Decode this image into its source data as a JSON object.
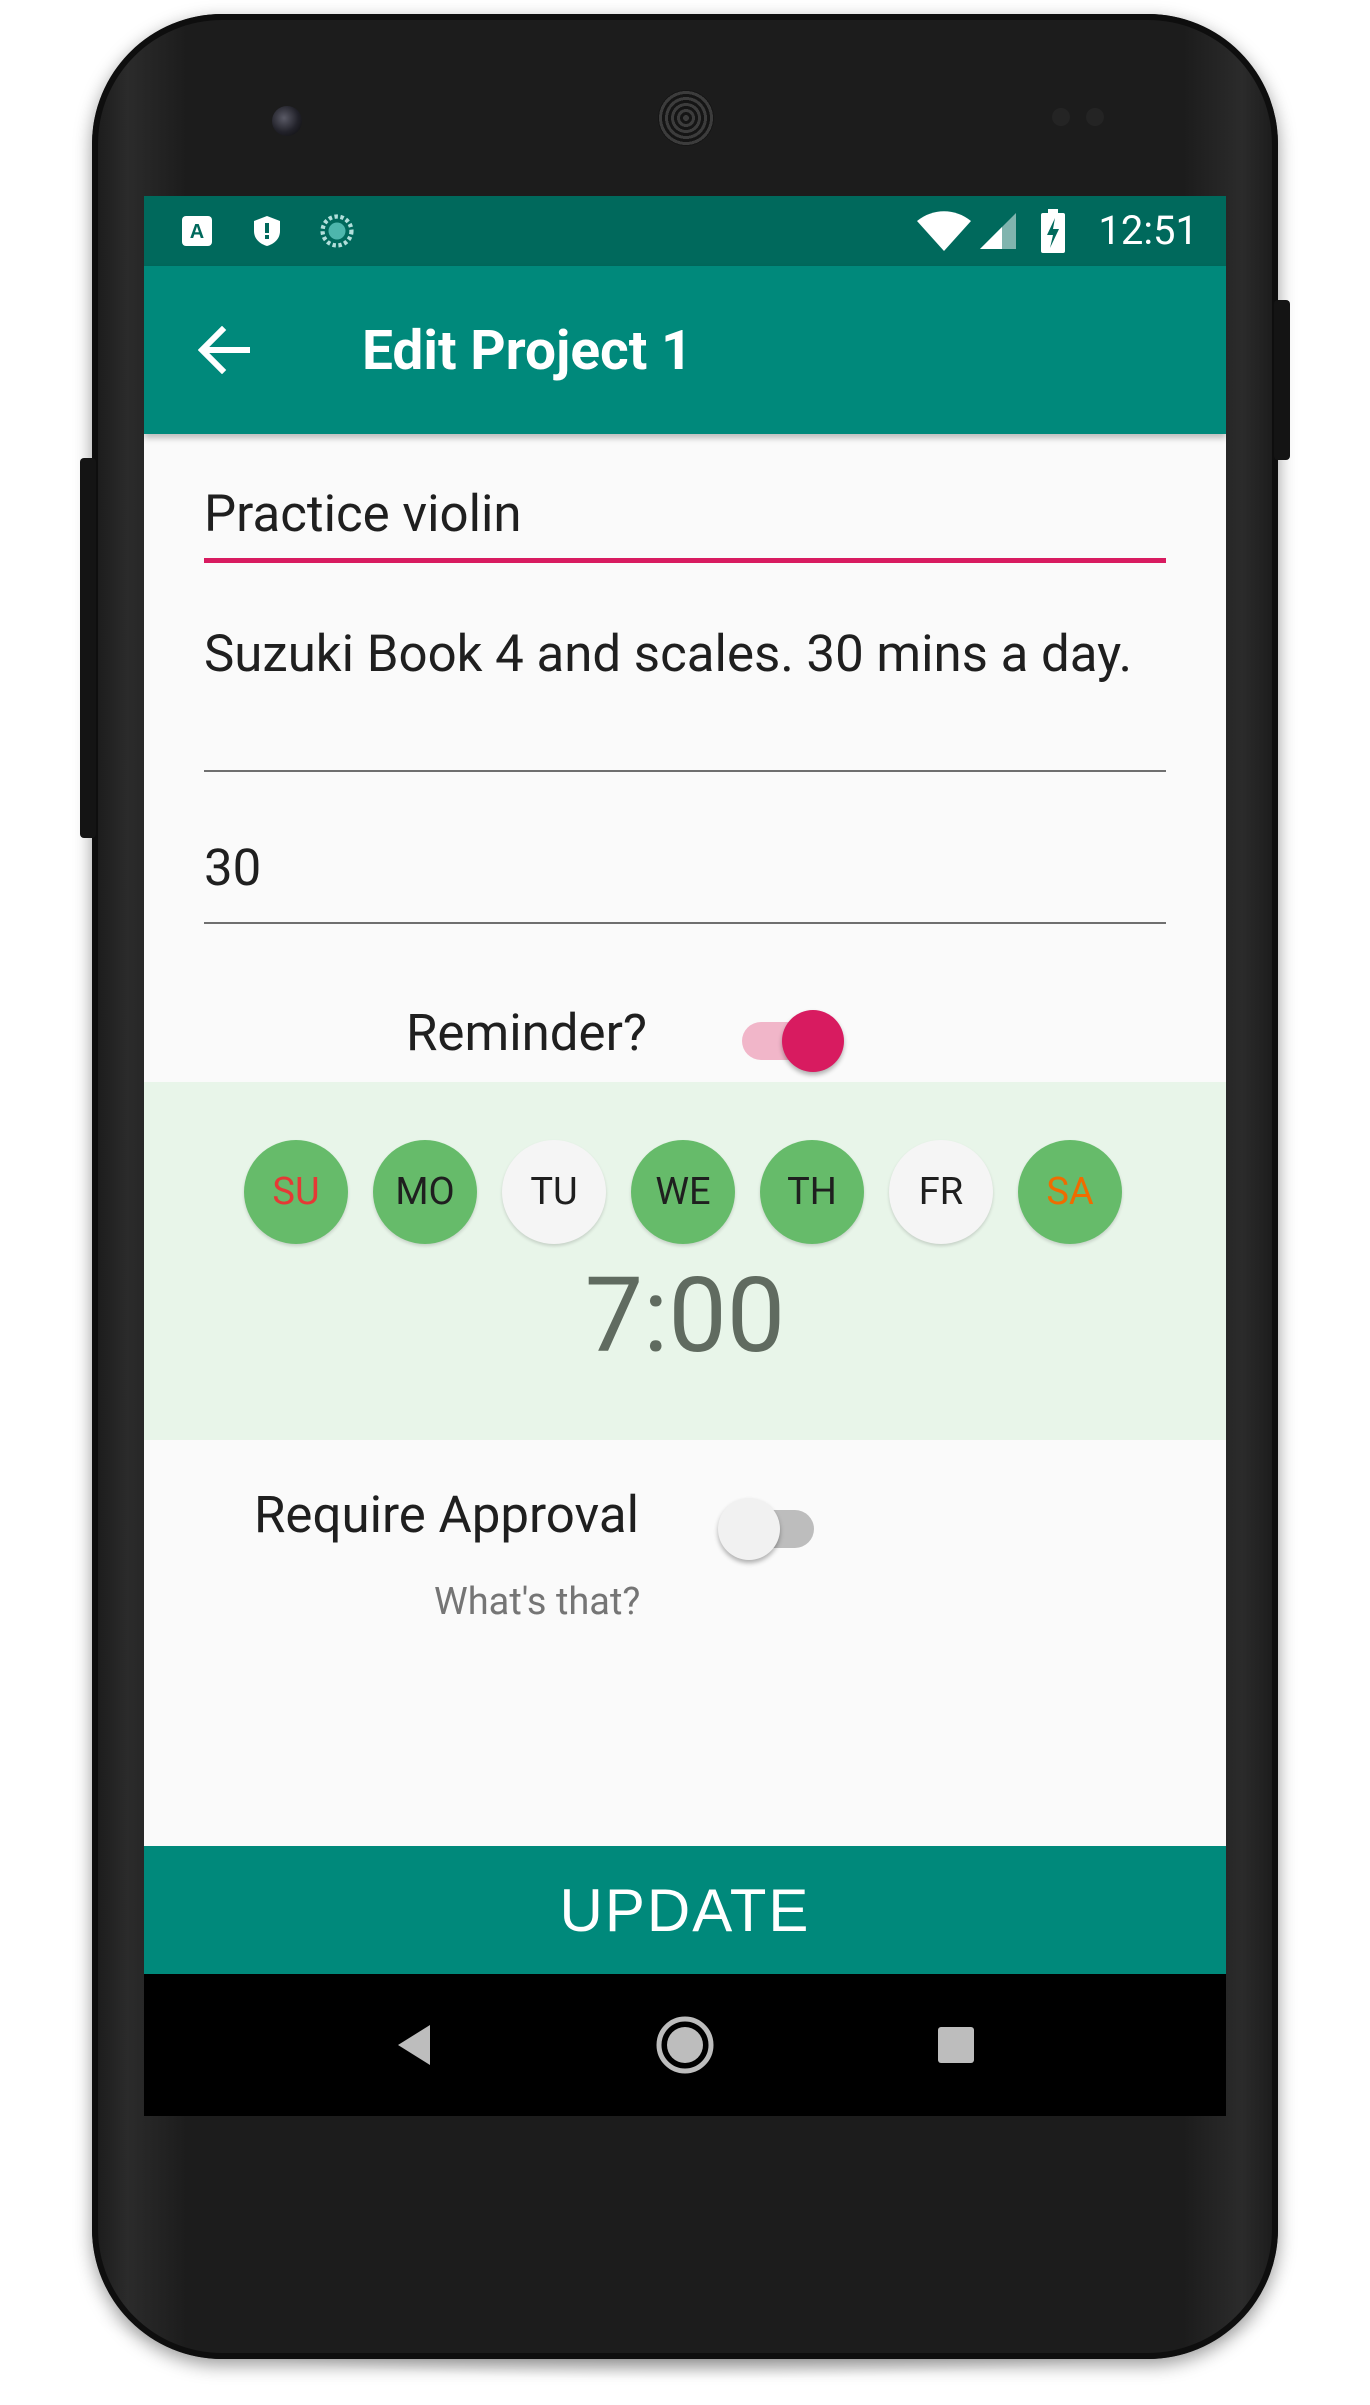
{
  "status_bar": {
    "time": "12:51",
    "left_icons": [
      "app-a-icon",
      "shield-icon",
      "sync-icon"
    ],
    "right_icons": [
      "wifi-icon",
      "cell-signal-icon",
      "battery-charging-icon"
    ]
  },
  "app_bar": {
    "back_icon": "arrow-left-icon",
    "title": "Edit Project 1"
  },
  "form": {
    "name_value": "Practice violin",
    "description_value": "Suzuki Book 4 and scales. 30 mins a day.",
    "minutes_value": "30"
  },
  "reminder": {
    "label": "Reminder?",
    "enabled": true,
    "days": [
      {
        "label": "SU",
        "selected": true,
        "color": "#e53935"
      },
      {
        "label": "MO",
        "selected": true,
        "color": "#1f1f1f"
      },
      {
        "label": "TU",
        "selected": false,
        "color": "#1f1f1f"
      },
      {
        "label": "WE",
        "selected": true,
        "color": "#1f1f1f"
      },
      {
        "label": "TH",
        "selected": true,
        "color": "#1f1f1f"
      },
      {
        "label": "FR",
        "selected": false,
        "color": "#1f1f1f"
      },
      {
        "label": "SA",
        "selected": true,
        "color": "#ef6c00"
      }
    ],
    "time": "7:00"
  },
  "approval": {
    "label": "Require Approval",
    "enabled": false,
    "help_link": "What's that?"
  },
  "actions": {
    "update_label": "UPDATE"
  },
  "nav_bar": {
    "icons": [
      "back-triangle-icon",
      "home-circle-icon",
      "recents-square-icon"
    ]
  },
  "colors": {
    "primary": "#00897b",
    "primary_dark": "#00695c",
    "accent": "#d81b60",
    "selected_day": "#66bb6a",
    "schedule_bg": "#e8f5e9"
  }
}
